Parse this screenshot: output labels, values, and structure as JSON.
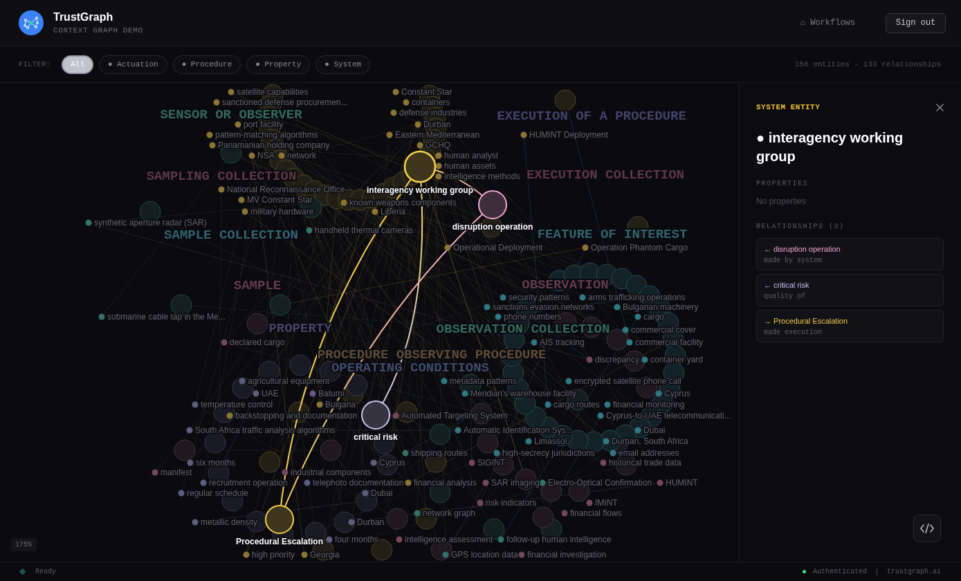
{
  "app": {
    "name": "TrustGraph",
    "subtitle": "CONTEXT GRAPH DEMO"
  },
  "nav": {
    "workflows": "⌂ Workflows",
    "sign_out": "Sign out"
  },
  "filter": {
    "label": "FILTER:",
    "chips": [
      {
        "label": "All",
        "selected": true
      },
      {
        "label": "● Actuation",
        "selected": false
      },
      {
        "label": "● Procedure",
        "selected": false
      },
      {
        "label": "● Property",
        "selected": false
      },
      {
        "label": "● System",
        "selected": false
      }
    ],
    "stats": "156 entities · 133 relationships"
  },
  "graph": {
    "zoom": "175%",
    "clusters": [
      {
        "label": "SENSOR OR OBSERVER",
        "color": "#346a5c"
      },
      {
        "label": "SAMPLING COLLECTION",
        "color": "#5e3844"
      },
      {
        "label": "SAMPLE COLLECTION",
        "color": "#31646f"
      },
      {
        "label": "EXECUTION OF A PROCEDURE",
        "color": "#46426a"
      },
      {
        "label": "EXECUTION COLLECTION",
        "color": "#5e3844"
      },
      {
        "label": "FEATURE OF INTEREST",
        "color": "#31646f"
      },
      {
        "label": "SAMPLE",
        "color": "#633c4a"
      },
      {
        "label": "OBSERVATION",
        "color": "#633c4a"
      },
      {
        "label": "PROPERTY",
        "color": "#4a4369"
      },
      {
        "label": "OBSERVATION COLLECTION",
        "color": "#346a5c"
      },
      {
        "label": "PROCEDURE OBSERVING PROCEDURE",
        "color": "#5e4c38"
      },
      {
        "label": "OPERATING CONDITIONS",
        "color": "#3e4c6b"
      }
    ],
    "nodes": [
      {
        "label": "satellite capabilities",
        "color": "#8a7533",
        "selected": false,
        "highlighted": false
      },
      {
        "label": "Constant Star",
        "color": "#8a7533",
        "selected": false,
        "highlighted": false
      },
      {
        "label": "sanctioned defense procuremen...",
        "color": "#8a7533",
        "selected": false,
        "highlighted": false
      },
      {
        "label": "containers",
        "color": "#8a7533",
        "selected": false,
        "highlighted": false
      },
      {
        "label": "defense industries",
        "color": "#8a7533",
        "selected": false,
        "highlighted": false
      },
      {
        "label": "port facility",
        "color": "#8a7533",
        "selected": false,
        "highlighted": false
      },
      {
        "label": "Durban",
        "color": "#8a7533",
        "selected": false,
        "highlighted": false
      },
      {
        "label": "pattern-matching algorithms",
        "color": "#8a7533",
        "selected": false,
        "highlighted": false
      },
      {
        "label": "Eastern Mediterranean",
        "color": "#8a7533",
        "selected": false,
        "highlighted": false
      },
      {
        "label": "HUMINT Deployment",
        "color": "#8a7533",
        "selected": false,
        "highlighted": false
      },
      {
        "label": "Panamanian holding company",
        "color": "#8a7533",
        "selected": false,
        "highlighted": false
      },
      {
        "label": "GCHQ",
        "color": "#8a7533",
        "selected": false,
        "highlighted": false
      },
      {
        "label": "NSA",
        "color": "#8a7533",
        "selected": false,
        "highlighted": false
      },
      {
        "label": "network",
        "color": "#8a7533",
        "selected": false,
        "highlighted": false
      },
      {
        "label": "human analyst",
        "color": "#8a7533",
        "selected": false,
        "highlighted": false
      },
      {
        "label": "human assets",
        "color": "#8a7533",
        "selected": false,
        "highlighted": false
      },
      {
        "label": "interagency working group",
        "color": "#f6d04d",
        "selected": true,
        "highlighted": true
      },
      {
        "label": "intelligence methods",
        "color": "#8a7533",
        "selected": false,
        "highlighted": false
      },
      {
        "label": "National Reconnaissance Office",
        "color": "#8a7533",
        "selected": false,
        "highlighted": false
      },
      {
        "label": "MV Constant Star",
        "color": "#8a7533",
        "selected": false,
        "highlighted": false
      },
      {
        "label": "known weapons components",
        "color": "#8a7533",
        "selected": false,
        "highlighted": false
      },
      {
        "label": "disruption operation",
        "color": "#f2a7cd",
        "selected": false,
        "highlighted": true
      },
      {
        "label": "military hardware",
        "color": "#8a7533",
        "selected": false,
        "highlighted": false
      },
      {
        "label": "Liberia",
        "color": "#8a7533",
        "selected": false,
        "highlighted": false
      },
      {
        "label": "synthetic aperture radar (SAR)",
        "color": "#2f7464",
        "selected": false,
        "highlighted": false
      },
      {
        "label": "handheld thermal cameras",
        "color": "#2f7464",
        "selected": false,
        "highlighted": false
      },
      {
        "label": "Operational Deployment",
        "color": "#8a7533",
        "selected": false,
        "highlighted": false
      },
      {
        "label": "Operation Phantom Cargo",
        "color": "#8a7533",
        "selected": false,
        "highlighted": false
      },
      {
        "label": "security patterns",
        "color": "#2f7884",
        "selected": false,
        "highlighted": false
      },
      {
        "label": "arms trafficking operations",
        "color": "#2f7884",
        "selected": false,
        "highlighted": false
      },
      {
        "label": "sanctions evasion networks",
        "color": "#2f7884",
        "selected": false,
        "highlighted": false
      },
      {
        "label": "Bulgarian machinery",
        "color": "#2f7884",
        "selected": false,
        "highlighted": false
      },
      {
        "label": "submarine cable tap in the Me...",
        "color": "#2f7464",
        "selected": false,
        "highlighted": false
      },
      {
        "label": "phone numbers",
        "color": "#2f7884",
        "selected": false,
        "highlighted": false
      },
      {
        "label": "cargo",
        "color": "#2f7884",
        "selected": false,
        "highlighted": false
      },
      {
        "label": "commercial cover",
        "color": "#2f7884",
        "selected": false,
        "highlighted": false
      },
      {
        "label": "declared cargo",
        "color": "#74485a",
        "selected": false,
        "highlighted": false
      },
      {
        "label": "AIS tracking",
        "color": "#2f7884",
        "selected": false,
        "highlighted": false
      },
      {
        "label": "commercial facility",
        "color": "#2f7884",
        "selected": false,
        "highlighted": false
      },
      {
        "label": "discrepancy",
        "color": "#74485a",
        "selected": false,
        "highlighted": false
      },
      {
        "label": "container yard",
        "color": "#2f7884",
        "selected": false,
        "highlighted": false
      },
      {
        "label": "agricultural equipment",
        "color": "#5e5d7c",
        "selected": false,
        "highlighted": false
      },
      {
        "label": "metadata patterns",
        "color": "#2f7884",
        "selected": false,
        "highlighted": false
      },
      {
        "label": "encrypted satellite phone call",
        "color": "#2f7884",
        "selected": false,
        "highlighted": false
      },
      {
        "label": "UAE",
        "color": "#5e5d7c",
        "selected": false,
        "highlighted": false
      },
      {
        "label": "Batumi",
        "color": "#5e5d7c",
        "selected": false,
        "highlighted": false
      },
      {
        "label": "Meridian's warehouse facility",
        "color": "#2f7884",
        "selected": false,
        "highlighted": false
      },
      {
        "label": "Cyprus",
        "color": "#2f7884",
        "selected": false,
        "highlighted": false
      },
      {
        "label": "temperature control",
        "color": "#5e5d7c",
        "selected": false,
        "highlighted": false
      },
      {
        "label": "Bulgaria",
        "color": "#8a7533",
        "selected": false,
        "highlighted": false
      },
      {
        "label": "cargo routes",
        "color": "#2f7884",
        "selected": false,
        "highlighted": false
      },
      {
        "label": "financial monitoring",
        "color": "#2f7884",
        "selected": false,
        "highlighted": false
      },
      {
        "label": "critical risk",
        "color": "#cdc6f0",
        "selected": false,
        "highlighted": true
      },
      {
        "label": "backstopping and documentation",
        "color": "#8a7533",
        "selected": false,
        "highlighted": false
      },
      {
        "label": "Automated Targeting System",
        "color": "#74485a",
        "selected": false,
        "highlighted": false
      },
      {
        "label": "Cyprus-to-UAE telecommunicati...",
        "color": "#2f7884",
        "selected": false,
        "highlighted": false
      },
      {
        "label": "South Africa traffic analysis algorithms",
        "color": "#5e5d7c",
        "selected": false,
        "highlighted": false
      },
      {
        "label": "Automatic Identification Sys...",
        "color": "#2f7884",
        "selected": false,
        "highlighted": false
      },
      {
        "label": "Dubai",
        "color": "#2f7884",
        "selected": false,
        "highlighted": false
      },
      {
        "label": "Limassol",
        "color": "#2f7884",
        "selected": false,
        "highlighted": false
      },
      {
        "label": "Durban, South Africa",
        "color": "#2f7884",
        "selected": false,
        "highlighted": false
      },
      {
        "label": "shipping routes",
        "color": "#2f7464",
        "selected": false,
        "highlighted": false
      },
      {
        "label": "high-secrecy jurisdictions",
        "color": "#2f7884",
        "selected": false,
        "highlighted": false
      },
      {
        "label": "email addresses",
        "color": "#2f7884",
        "selected": false,
        "highlighted": false
      },
      {
        "label": "six months",
        "color": "#5e5d7c",
        "selected": false,
        "highlighted": false
      },
      {
        "label": "Cyprus",
        "color": "#5e5d7c",
        "selected": false,
        "highlighted": false
      },
      {
        "label": "SIGINT",
        "color": "#74485a",
        "selected": false,
        "highlighted": false
      },
      {
        "label": "historical trade data",
        "color": "#74485a",
        "selected": false,
        "highlighted": false
      },
      {
        "label": "manifest",
        "color": "#74485a",
        "selected": false,
        "highlighted": false
      },
      {
        "label": "industrial components",
        "color": "#74485a",
        "selected": false,
        "highlighted": false
      },
      {
        "label": "recruitment operation",
        "color": "#5e5d7c",
        "selected": false,
        "highlighted": false
      },
      {
        "label": "telephoto documentation",
        "color": "#5e5d7c",
        "selected": false,
        "highlighted": false
      },
      {
        "label": "financial analysis",
        "color": "#8a7533",
        "selected": false,
        "highlighted": false
      },
      {
        "label": "SAR imaging",
        "color": "#74485a",
        "selected": false,
        "highlighted": false
      },
      {
        "label": "Electro-Optical Confirmation",
        "color": "#2f7464",
        "selected": false,
        "highlighted": false
      },
      {
        "label": "HUMINT",
        "color": "#74485a",
        "selected": false,
        "highlighted": false
      },
      {
        "label": "regular schedule",
        "color": "#5e5d7c",
        "selected": false,
        "highlighted": false
      },
      {
        "label": "Dubai",
        "color": "#5e5d7c",
        "selected": false,
        "highlighted": false
      },
      {
        "label": "risk indicators",
        "color": "#74485a",
        "selected": false,
        "highlighted": false
      },
      {
        "label": "IMINT",
        "color": "#74485a",
        "selected": false,
        "highlighted": false
      },
      {
        "label": "network graph",
        "color": "#2f7464",
        "selected": false,
        "highlighted": false
      },
      {
        "label": "financial flows",
        "color": "#74485a",
        "selected": false,
        "highlighted": false
      },
      {
        "label": "Procedural Escalation",
        "color": "#f6d04d",
        "selected": false,
        "highlighted": true
      },
      {
        "label": "metallic density",
        "color": "#5e5d7c",
        "selected": false,
        "highlighted": false
      },
      {
        "label": "Durban",
        "color": "#5e5d7c",
        "selected": false,
        "highlighted": false
      },
      {
        "label": "four months",
        "color": "#5e5d7c",
        "selected": false,
        "highlighted": false
      },
      {
        "label": "intelligence assessment",
        "color": "#74485a",
        "selected": false,
        "highlighted": false
      },
      {
        "label": "follow-up human intelligence",
        "color": "#2f7464",
        "selected": false,
        "highlighted": false
      },
      {
        "label": "high priority",
        "color": "#8a7533",
        "selected": false,
        "highlighted": false
      },
      {
        "label": "Georgia",
        "color": "#8a7533",
        "selected": false,
        "highlighted": false
      },
      {
        "label": "GPS location data",
        "color": "#2f7464",
        "selected": false,
        "highlighted": false
      },
      {
        "label": "financial investigation",
        "color": "#74485a",
        "selected": false,
        "highlighted": false
      }
    ]
  },
  "panel": {
    "kind": "SYSTEM ENTITY",
    "title": "● interagency working group",
    "properties_heading": "PROPERTIES",
    "properties_empty": "No properties",
    "relationships_heading": "RELATIONSHIPS (3)",
    "relationships": [
      {
        "label": "← disruption operation",
        "predicate": "made by system",
        "color": "#f2a7cd"
      },
      {
        "label": "← critical risk",
        "predicate": "quality of",
        "color": "#c7bff2"
      },
      {
        "label": "→ Procedural Escalation",
        "predicate": "made execution",
        "color": "#f3c94b"
      }
    ]
  },
  "status": {
    "text": "Ready",
    "auth": "Authenticated",
    "domain": "trustgraph.ai"
  }
}
